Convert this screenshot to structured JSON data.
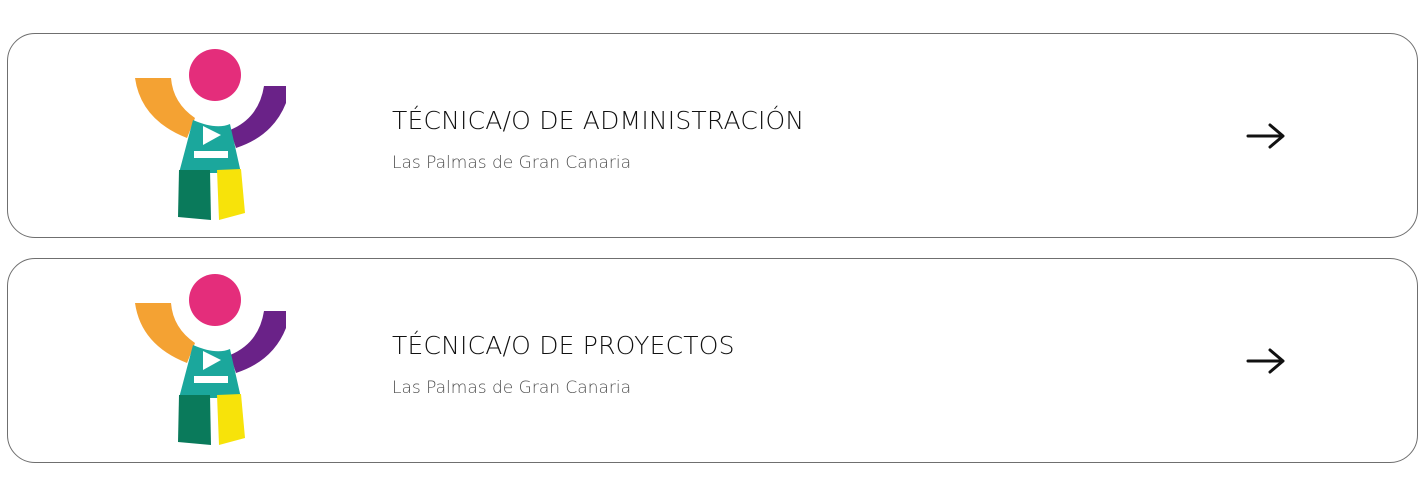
{
  "jobs": [
    {
      "title": "TÉCNICA/O DE ADMINISTRACIÓN",
      "location": "Las Palmas de Gran Canaria"
    },
    {
      "title": "TÉCNICA/O DE PROYECTOS",
      "location": "Las Palmas de Gran Canaria"
    }
  ],
  "icons": {
    "logo": "figure-logo-icon",
    "arrow": "arrow-right-icon"
  },
  "colors": {
    "logo_head": "#e42d7b",
    "logo_left_arm": "#f4a233",
    "logo_right_arm": "#6a2288",
    "logo_body": "#1ba79c",
    "logo_left_leg": "#0a7a5b",
    "logo_right_leg": "#f7e30a",
    "card_border": "#6f6f6f"
  }
}
